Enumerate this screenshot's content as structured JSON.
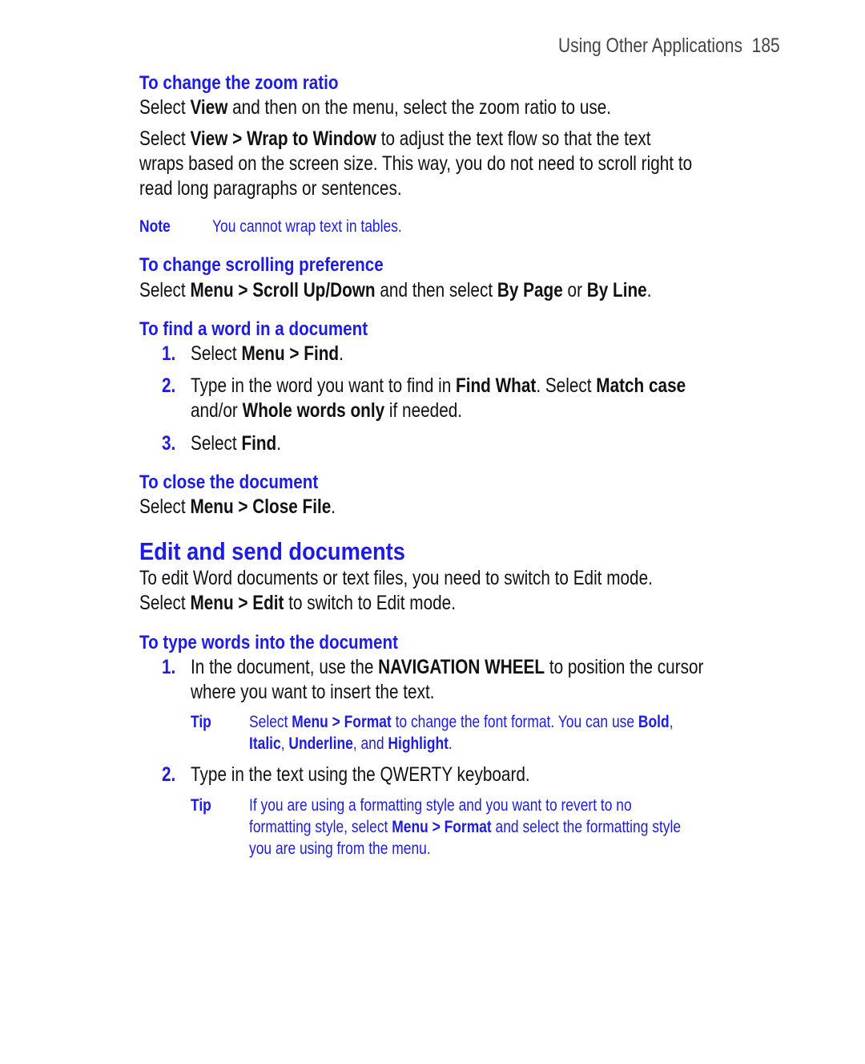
{
  "header": {
    "section": "Using Other Applications",
    "page_number": "185"
  },
  "colors": {
    "accent": "#1c1ce6",
    "text": "#111111"
  },
  "zoom_ratio": {
    "heading": "To change the zoom ratio",
    "p1": [
      {
        "t": "Select "
      },
      {
        "t": "View",
        "b": true
      },
      {
        "t": " and then on the menu, select the zoom ratio to use."
      }
    ],
    "p2_lines": [
      [
        {
          "t": "Select "
        },
        {
          "t": "View > Wrap to Window",
          "b": true
        },
        {
          "t": " to adjust the text flow so that the text"
        }
      ],
      [
        {
          "t": "wraps based on the screen size. This way, you do not need to scroll right to"
        }
      ],
      [
        {
          "t": "read long paragraphs or sentences."
        }
      ]
    ],
    "note_label": "Note",
    "note_text": "You cannot wrap text in tables."
  },
  "scrolling": {
    "heading": "To change scrolling preference",
    "p1": [
      {
        "t": "Select "
      },
      {
        "t": "Menu > Scroll Up/Down",
        "b": true
      },
      {
        "t": " and then select "
      },
      {
        "t": "By Page",
        "b": true
      },
      {
        "t": " or "
      },
      {
        "t": "By Line",
        "b": true
      },
      {
        "t": "."
      }
    ]
  },
  "find_word": {
    "heading": "To find a word in a document",
    "steps": [
      {
        "num": "1.",
        "lines": [
          [
            {
              "t": "Select "
            },
            {
              "t": "Menu > Find",
              "b": true
            },
            {
              "t": "."
            }
          ]
        ]
      },
      {
        "num": "2.",
        "lines": [
          [
            {
              "t": "Type in the word you want to find in "
            },
            {
              "t": "Find What",
              "b": true
            },
            {
              "t": ". Select "
            },
            {
              "t": "Match case",
              "b": true
            }
          ],
          [
            {
              "t": "and/or "
            },
            {
              "t": "Whole words only",
              "b": true
            },
            {
              "t": " if needed."
            }
          ]
        ]
      },
      {
        "num": "3.",
        "lines": [
          [
            {
              "t": "Select "
            },
            {
              "t": "Find",
              "b": true
            },
            {
              "t": "."
            }
          ]
        ]
      }
    ]
  },
  "close_doc": {
    "heading": "To close the document",
    "p1": [
      {
        "t": "Select "
      },
      {
        "t": "Menu > Close File",
        "b": true
      },
      {
        "t": "."
      }
    ]
  },
  "edit_send": {
    "title": "Edit and send documents",
    "lines": [
      [
        {
          "t": "To edit Word documents or text files, you need to switch to Edit mode."
        }
      ],
      [
        {
          "t": "Select "
        },
        {
          "t": "Menu > Edit",
          "b": true
        },
        {
          "t": " to switch to Edit mode."
        }
      ]
    ]
  },
  "type_words": {
    "heading": "To type words into the document",
    "steps": [
      {
        "num": "1.",
        "lines": [
          [
            {
              "t": "In the document, use the "
            },
            {
              "t": "NAVIGATION WHEEL",
              "b": true
            },
            {
              "t": " to position the cursor"
            }
          ],
          [
            {
              "t": "where you want to insert the text."
            }
          ]
        ],
        "tip_label": "Tip",
        "tip_lines": [
          [
            {
              "t": "Select "
            },
            {
              "t": "Menu > Format",
              "b": true
            },
            {
              "t": " to change the font format. You can use "
            },
            {
              "t": "Bold",
              "b": true
            },
            {
              "t": ","
            }
          ],
          [
            {
              "t": "Italic",
              "b": true
            },
            {
              "t": ", "
            },
            {
              "t": "Underline",
              "b": true
            },
            {
              "t": ", and "
            },
            {
              "t": "Highlight",
              "b": true
            },
            {
              "t": "."
            }
          ]
        ]
      },
      {
        "num": "2.",
        "lines": [
          [
            {
              "t": "Type in the text using the QWERTY keyboard."
            }
          ]
        ],
        "tip_label": "Tip",
        "tip_lines": [
          [
            {
              "t": "If you are using a formatting style and you want to revert to no"
            }
          ],
          [
            {
              "t": "formatting style, select "
            },
            {
              "t": "Menu > Format",
              "b": true
            },
            {
              "t": " and select the formatting style"
            }
          ],
          [
            {
              "t": "you are using from the menu."
            }
          ]
        ]
      }
    ]
  }
}
